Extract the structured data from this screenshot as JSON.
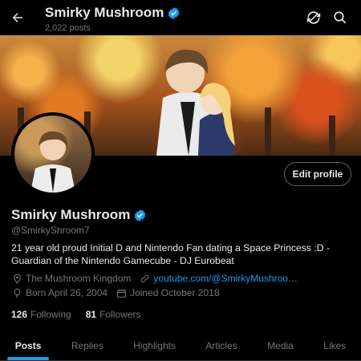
{
  "header": {
    "name": "Smirky Mushroom",
    "post_count": "2,022 posts"
  },
  "profile": {
    "display_name": "Smirky Mushroom",
    "handle": "@SmirkyShroom7",
    "bio": "21 year old proud Initial D and Nintendo Fan dating a Space Princess :D - Guardian of the Nintendo Gamecube - DJ Eurobeat",
    "location": "The Mushroom Kingdom",
    "website": "youtube.com/@SmirkyMushroo…",
    "born": "Born April 26, 2004",
    "joined": "Joined October 2018",
    "edit_label": "Edit profile"
  },
  "stats": {
    "following_count": "126",
    "following_label": "Following",
    "followers_count": "81",
    "followers_label": "Followers"
  },
  "tabs": [
    {
      "label": "Posts",
      "active": true
    },
    {
      "label": "Replies"
    },
    {
      "label": "Highlights"
    },
    {
      "label": "Articles"
    },
    {
      "label": "Media"
    },
    {
      "label": "Likes"
    }
  ],
  "icons": {
    "back": "arrow-left-icon",
    "refresh": "refresh-icon",
    "search": "search-icon",
    "verified": "verified-badge-icon",
    "location": "location-pin-icon",
    "link": "link-icon",
    "birthday": "balloon-icon",
    "calendar": "calendar-icon"
  },
  "colors": {
    "accent": "#1d9bf0",
    "background": "#000000",
    "text": "#e7e9ea",
    "muted": "#71767b"
  }
}
